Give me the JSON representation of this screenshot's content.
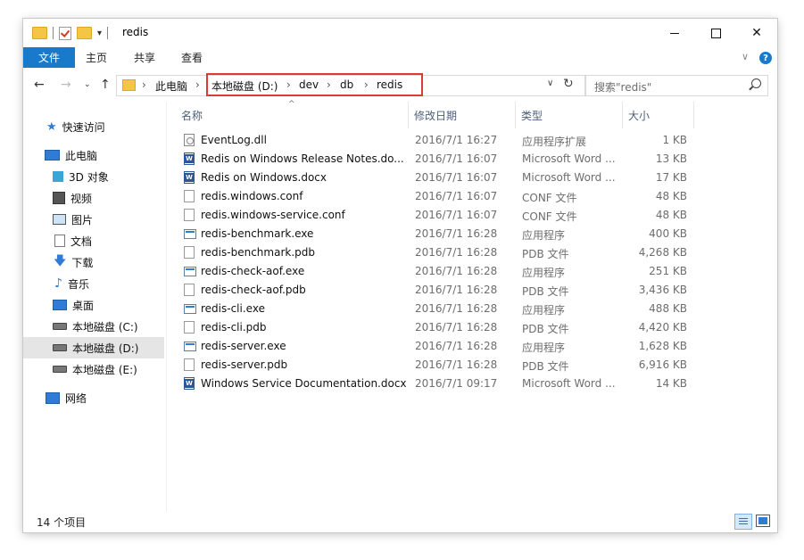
{
  "window": {
    "title": "redis"
  },
  "ribbon": {
    "file_tab": "文件",
    "home_tab": "主页",
    "share_tab": "共享",
    "view_tab": "查看"
  },
  "address": {
    "crumbs": [
      "此电脑",
      "本地磁盘 (D:)",
      "dev",
      "db",
      "redis"
    ]
  },
  "search": {
    "placeholder": "搜索\"redis\""
  },
  "nav": {
    "quick_access": "快速访问",
    "this_pc": "此电脑",
    "items": [
      "3D 对象",
      "视频",
      "图片",
      "文档",
      "下载",
      "音乐",
      "桌面",
      "本地磁盘 (C:)",
      "本地磁盘 (D:)",
      "本地磁盘 (E:)"
    ],
    "network": "网络",
    "selected": "本地磁盘 (D:)"
  },
  "columns": {
    "name": "名称",
    "date": "修改日期",
    "type": "类型",
    "size": "大小"
  },
  "files": [
    {
      "icon": "dll-icon",
      "name": "EventLog.dll",
      "date": "2016/7/1 16:27",
      "type": "应用程序扩展",
      "size": "1 KB"
    },
    {
      "icon": "word-icon",
      "name": "Redis on Windows Release Notes.do...",
      "date": "2016/7/1 16:07",
      "type": "Microsoft Word ...",
      "size": "13 KB"
    },
    {
      "icon": "word-icon",
      "name": "Redis on Windows.docx",
      "date": "2016/7/1 16:07",
      "type": "Microsoft Word ...",
      "size": "17 KB"
    },
    {
      "icon": "file-icon",
      "name": "redis.windows.conf",
      "date": "2016/7/1 16:07",
      "type": "CONF 文件",
      "size": "48 KB"
    },
    {
      "icon": "file-icon",
      "name": "redis.windows-service.conf",
      "date": "2016/7/1 16:07",
      "type": "CONF 文件",
      "size": "48 KB"
    },
    {
      "icon": "exe-icon",
      "name": "redis-benchmark.exe",
      "date": "2016/7/1 16:28",
      "type": "应用程序",
      "size": "400 KB"
    },
    {
      "icon": "file-icon",
      "name": "redis-benchmark.pdb",
      "date": "2016/7/1 16:28",
      "type": "PDB 文件",
      "size": "4,268 KB"
    },
    {
      "icon": "exe-icon",
      "name": "redis-check-aof.exe",
      "date": "2016/7/1 16:28",
      "type": "应用程序",
      "size": "251 KB"
    },
    {
      "icon": "file-icon",
      "name": "redis-check-aof.pdb",
      "date": "2016/7/1 16:28",
      "type": "PDB 文件",
      "size": "3,436 KB"
    },
    {
      "icon": "exe-icon",
      "name": "redis-cli.exe",
      "date": "2016/7/1 16:28",
      "type": "应用程序",
      "size": "488 KB"
    },
    {
      "icon": "file-icon",
      "name": "redis-cli.pdb",
      "date": "2016/7/1 16:28",
      "type": "PDB 文件",
      "size": "4,420 KB"
    },
    {
      "icon": "exe-icon",
      "name": "redis-server.exe",
      "date": "2016/7/1 16:28",
      "type": "应用程序",
      "size": "1,628 KB"
    },
    {
      "icon": "file-icon",
      "name": "redis-server.pdb",
      "date": "2016/7/1 16:28",
      "type": "PDB 文件",
      "size": "6,916 KB"
    },
    {
      "icon": "word-icon",
      "name": "Windows Service Documentation.docx",
      "date": "2016/7/1 09:17",
      "type": "Microsoft Word ...",
      "size": "14 KB"
    }
  ],
  "status": {
    "item_count": "14 个项目"
  },
  "colors": {
    "accent": "#1979ca",
    "highlight_border": "#d93a3a"
  }
}
